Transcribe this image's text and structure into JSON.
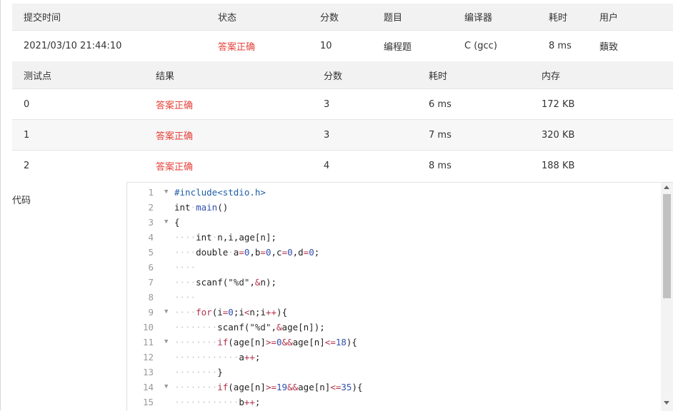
{
  "submission": {
    "headers": [
      "提交时间",
      "状态",
      "分数",
      "题目",
      "编译器",
      "耗时",
      "用户"
    ],
    "row": [
      "2021/03/10 21:44:10",
      "答案正确",
      "10",
      "编程题",
      "C (gcc)",
      "8 ms",
      "蘱致"
    ]
  },
  "cases": {
    "headers": [
      "测试点",
      "结果",
      "分数",
      "耗时",
      "内存"
    ],
    "rows": [
      [
        "0",
        "答案正确",
        "3",
        "6 ms",
        "172 KB"
      ],
      [
        "1",
        "答案正确",
        "3",
        "7 ms",
        "320 KB"
      ],
      [
        "2",
        "答案正确",
        "4",
        "8 ms",
        "188 KB"
      ]
    ]
  },
  "code_label": "代码",
  "code_lines": [
    {
      "n": "1",
      "fold": "▼",
      "text": "#include<stdio.h>"
    },
    {
      "n": "2",
      "fold": "",
      "text": "int·main()"
    },
    {
      "n": "3",
      "fold": "▼",
      "text": "{"
    },
    {
      "n": "4",
      "fold": "",
      "text": "····int·n,i,age[n];"
    },
    {
      "n": "5",
      "fold": "",
      "text": "····double·a=0,b=0,c=0,d=0;"
    },
    {
      "n": "6",
      "fold": "",
      "text": "····"
    },
    {
      "n": "7",
      "fold": "",
      "text": "····scanf(\"%d\",&n);"
    },
    {
      "n": "8",
      "fold": "",
      "text": "····"
    },
    {
      "n": "9",
      "fold": "▼",
      "text": "····for(i=0;i<n;i++){"
    },
    {
      "n": "10",
      "fold": "",
      "text": "········scanf(\"%d\",&age[n]);"
    },
    {
      "n": "11",
      "fold": "▼",
      "text": "········if(age[n]>=0&&age[n]<=18){"
    },
    {
      "n": "12",
      "fold": "",
      "text": "············a++;"
    },
    {
      "n": "13",
      "fold": "",
      "text": "········}"
    },
    {
      "n": "14",
      "fold": "▼",
      "text": "········if(age[n]>=19&&age[n]<=35){"
    },
    {
      "n": "15",
      "fold": "",
      "text": "············b++;"
    }
  ]
}
